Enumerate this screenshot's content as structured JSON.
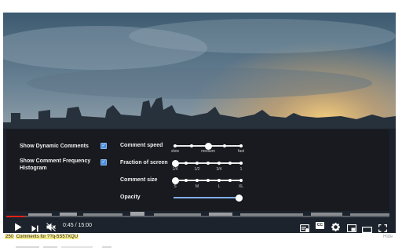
{
  "video": {
    "time_current": "0:45",
    "time_total": "15:00",
    "progress_fraction": 0.05
  },
  "overlay": {
    "show_dynamic_comments": {
      "label": "Show Dynamic Comments",
      "checked": true
    },
    "show_histogram": {
      "label": "Show Comment Frequency Histogram",
      "checked": true
    },
    "comment_speed": {
      "label": "Comment speed",
      "ticks": [
        "slow",
        "medium",
        "fast"
      ],
      "value_index": 1,
      "steps": 5
    },
    "fraction_of_screen": {
      "label": "Fraction of screen",
      "ticks": [
        "1/4",
        "1/2",
        "3/4",
        "1"
      ],
      "value_index": 0,
      "steps": 7
    },
    "comment_size": {
      "label": "Comment size",
      "ticks": [
        "S",
        "M",
        "L",
        "XL"
      ],
      "value_index": 0,
      "steps": 7
    },
    "opacity": {
      "label": "Opacity",
      "value_fraction": 1.0
    }
  },
  "controls": {
    "icons": [
      "play-icon",
      "next-icon",
      "mute-icon",
      "comments-toggle-icon",
      "subtitles-icon",
      "settings-icon",
      "miniplayer-icon",
      "theater-icon",
      "fullscreen-icon"
    ],
    "cc_label": "CC"
  },
  "footer": {
    "comment_count": "250",
    "caption_text": "Comments for ??q-5S57XQU",
    "hide_label": "Hide"
  },
  "colors": {
    "accent": "#4a90e2",
    "progress": "#e62117",
    "highlight": "#f6e98a"
  }
}
